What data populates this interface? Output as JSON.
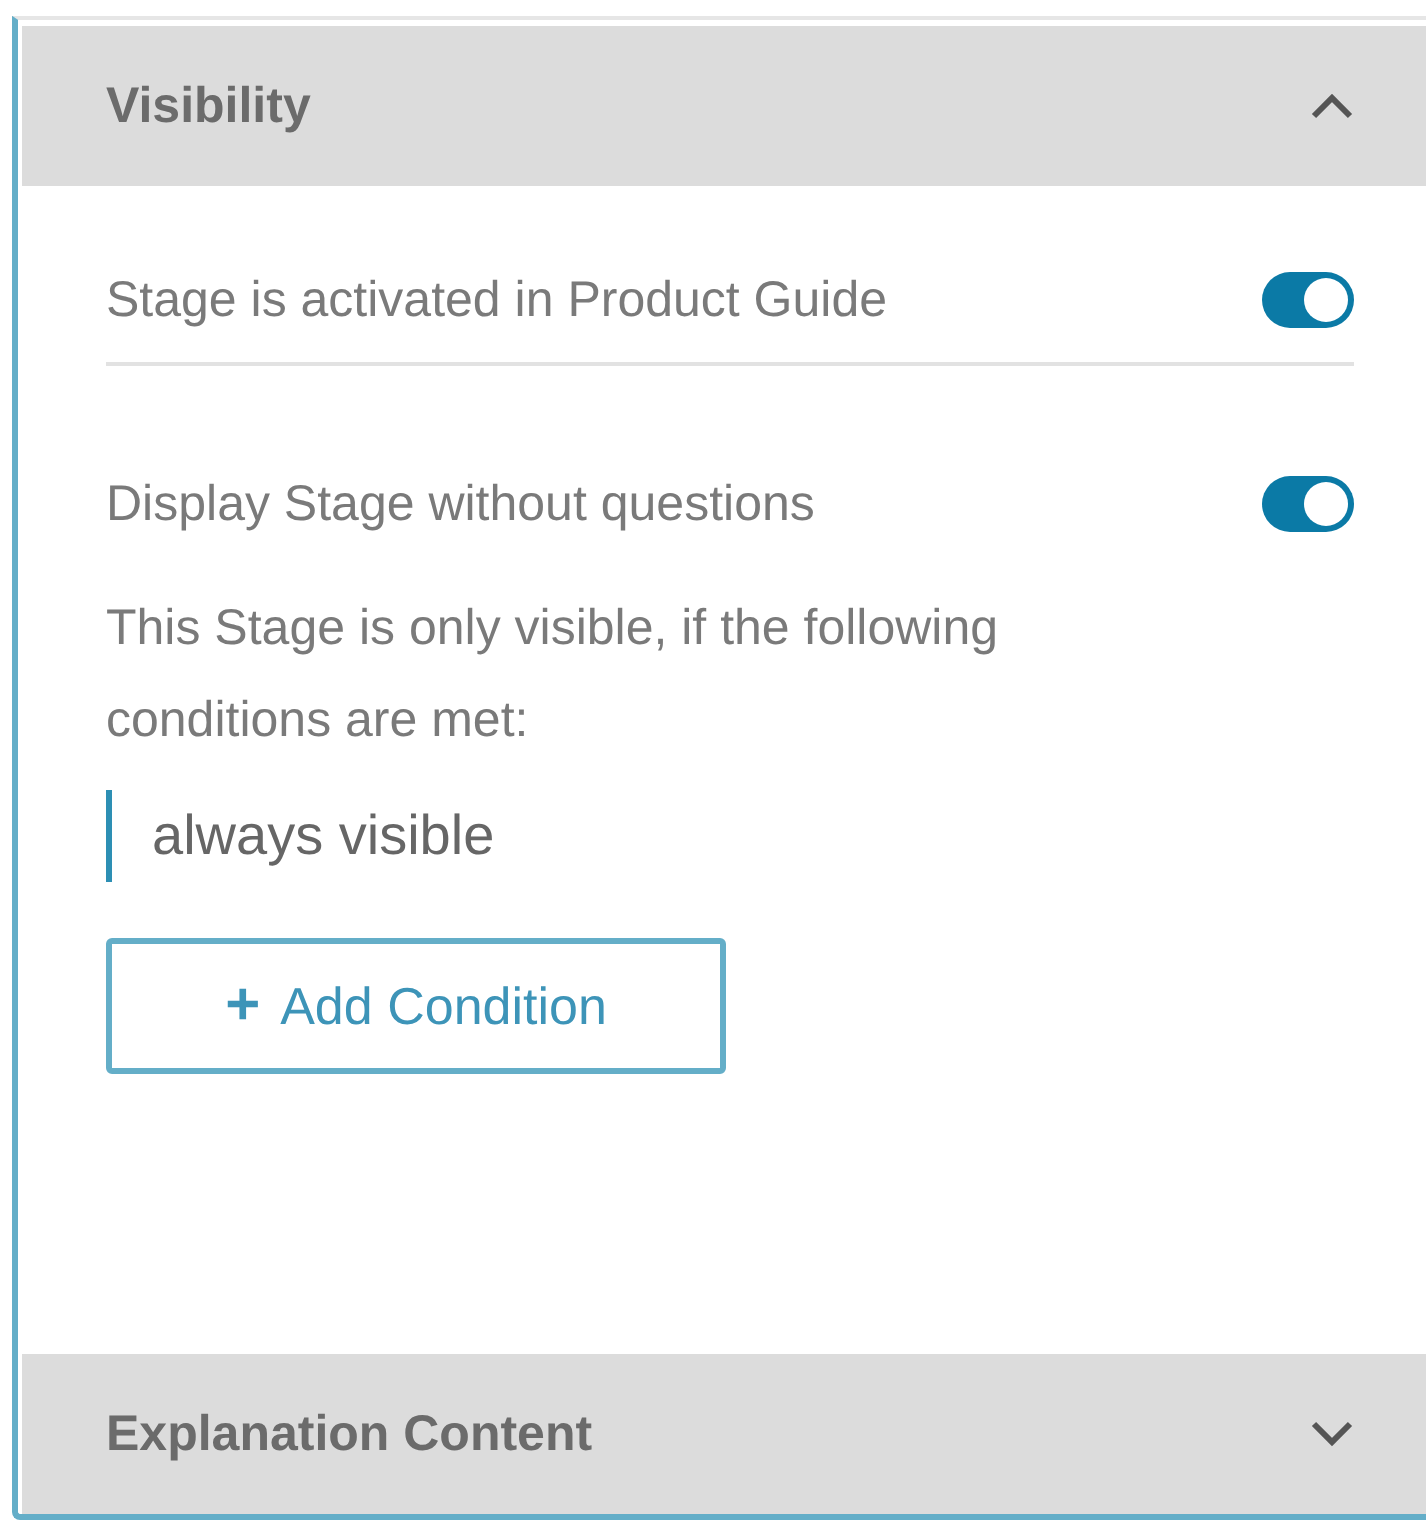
{
  "sections": [
    {
      "title": "Visibility",
      "expanded": true,
      "toggles": [
        {
          "label": "Stage is activated in Product Guide",
          "on": true
        },
        {
          "label": "Display Stage without questions",
          "on": true
        }
      ],
      "description": "This Stage is only visible, if the following conditions are met:",
      "conditions": [
        "always visible"
      ],
      "add_button": {
        "icon": "+",
        "label": "Add Condition"
      }
    },
    {
      "title": "Explanation Content",
      "expanded": false
    }
  ]
}
